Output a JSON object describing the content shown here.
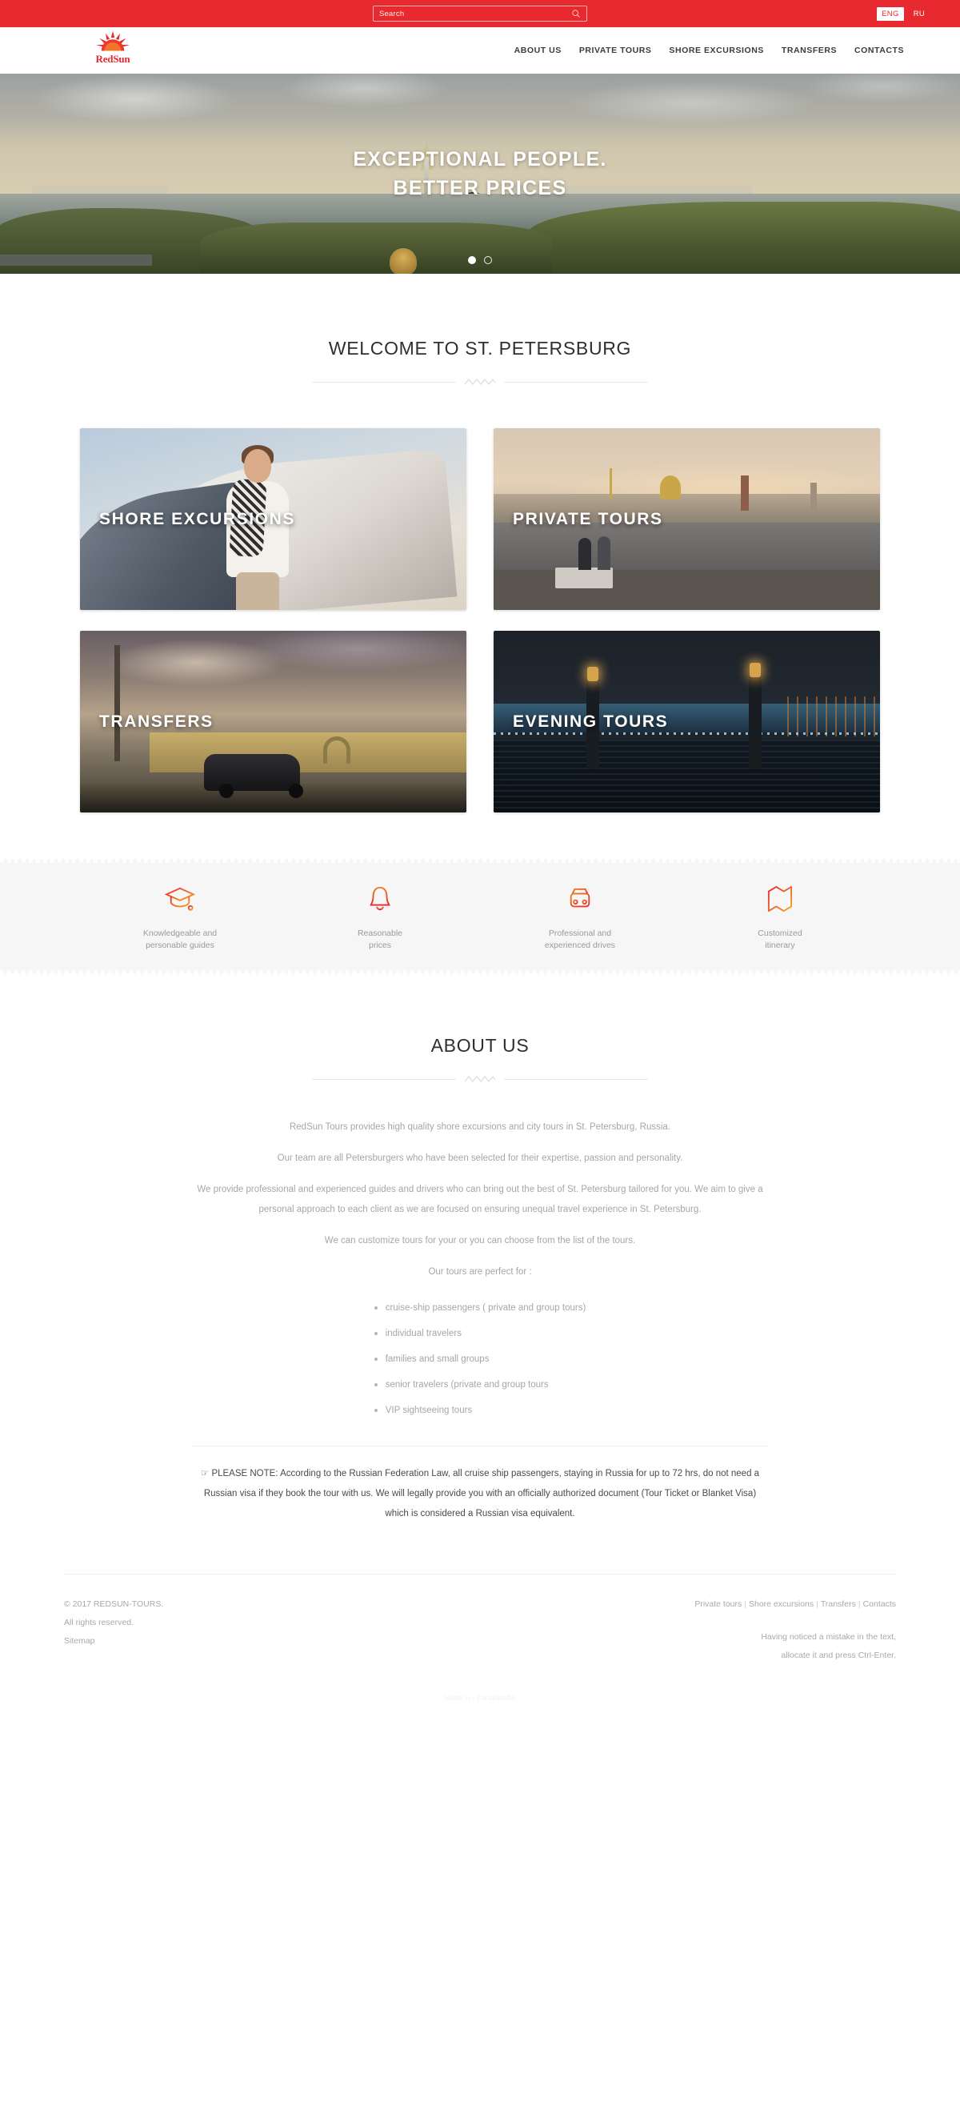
{
  "topbar": {
    "search_placeholder": "Search",
    "search_value": "",
    "search_icon": "search-icon",
    "languages": [
      {
        "code": "ENG",
        "active": true
      },
      {
        "code": "RU",
        "active": false
      }
    ]
  },
  "brand": {
    "name": "RedSun",
    "logo_icon": "sun-logo-icon",
    "color": "#e8292f"
  },
  "nav": {
    "items": [
      {
        "label": "ABOUT US"
      },
      {
        "label": "PRIVATE TOURS"
      },
      {
        "label": "SHORE EXCURSIONS"
      },
      {
        "label": "TRANSFERS"
      },
      {
        "label": "CONTACTS"
      }
    ]
  },
  "hero": {
    "line1": "EXCEPTIONAL PEOPLE.",
    "line2": "BETTER PRICES",
    "slides": [
      {
        "index": 1,
        "active": true
      },
      {
        "index": 2,
        "active": false
      }
    ]
  },
  "welcome": {
    "title": "WELCOME TO ST. PETERSBURG"
  },
  "cards": [
    {
      "label": "SHORE EXCURSIONS",
      "theme": "bg-shore"
    },
    {
      "label": "PRIVATE TOURS",
      "theme": "bg-private"
    },
    {
      "label": "TRANSFERS",
      "theme": "bg-transfers"
    },
    {
      "label": "EVENING TOURS",
      "theme": "bg-evening"
    }
  ],
  "features": [
    {
      "icon": "graduation-cap-icon",
      "line1": "Knowledgeable and",
      "line2": "personable guides"
    },
    {
      "icon": "bell-icon",
      "line1": "Reasonable",
      "line2": "prices"
    },
    {
      "icon": "car-icon",
      "line1": "Professional and",
      "line2": "experienced drives"
    },
    {
      "icon": "map-icon",
      "line1": "Customized",
      "line2": "itinerary"
    }
  ],
  "about": {
    "title": "ABOUT US",
    "paragraphs": [
      "RedSun Tours provides high quality shore excursions and city tours in St. Petersburg, Russia.",
      "Our team are all Petersburgers who have been selected for their expertise, passion and personality.",
      "We provide professional and experienced guides and drivers who can bring out the best of St. Petersburg tailored for you. We aim to give a personal approach to each client as we are focused on ensuring unequal travel experience in St. Petersburg.",
      "We can customize tours for your or you can choose from the list of the tours.",
      "Our tours are perfect for :"
    ],
    "list": [
      "cruise-ship passengers ( private and group tours)",
      "individual travelers",
      "families and small groups",
      "senior travelers (private and group tours",
      "VIP sightseeing tours"
    ],
    "note_icon": "pointing-hand-icon",
    "note": "PLEASE NOTE: According to the Russian Federation Law, all cruise ship passengers, staying in Russia for up to 72 hrs, do not need a Russian visa if they book the tour with us. We will legally provide you with an officially authorized document (Tour Ticket or Blanket Visa) which is considered a Russian visa equivalent."
  },
  "footer": {
    "copyright": "© 2017 REDSUN-TOURS.",
    "rights": "All rights reserved.",
    "sitemap": "Sitemap",
    "links": [
      {
        "label": "Private tours"
      },
      {
        "label": "Shore excursions"
      },
      {
        "label": "Transfers"
      },
      {
        "label": "Contacts"
      }
    ],
    "mistake_line1": "Having noticed a mistake in the text,",
    "mistake_line2": "allocate it and press Ctrl-Enter.",
    "made_in": "Made in - FantaStudio"
  }
}
